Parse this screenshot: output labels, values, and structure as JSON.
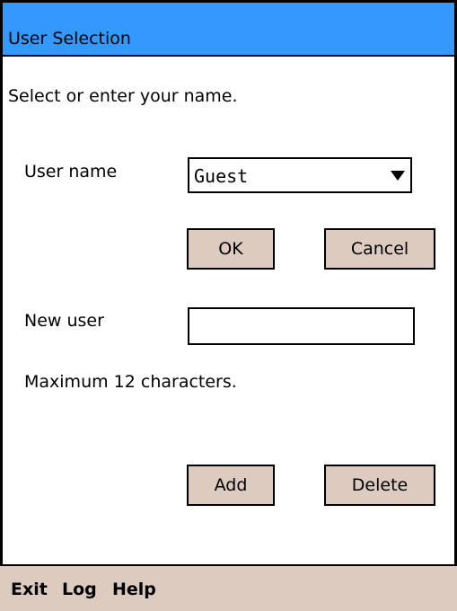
{
  "window": {
    "title": "User Selection"
  },
  "prompt": "Select or enter your name.",
  "user_name": {
    "label": "User name",
    "selected": "Guest"
  },
  "buttons": {
    "ok": "OK",
    "cancel": "Cancel",
    "add": "Add",
    "delete": "Delete"
  },
  "new_user": {
    "label": "New user",
    "value": "",
    "hint": "Maximum 12 characters."
  },
  "menu": {
    "items": [
      "Exit",
      "Log",
      "Help"
    ]
  },
  "colors": {
    "titlebar": "#3399ff",
    "button_bg": "#ddcbc0",
    "menu_bg": "#ddcbc0"
  }
}
